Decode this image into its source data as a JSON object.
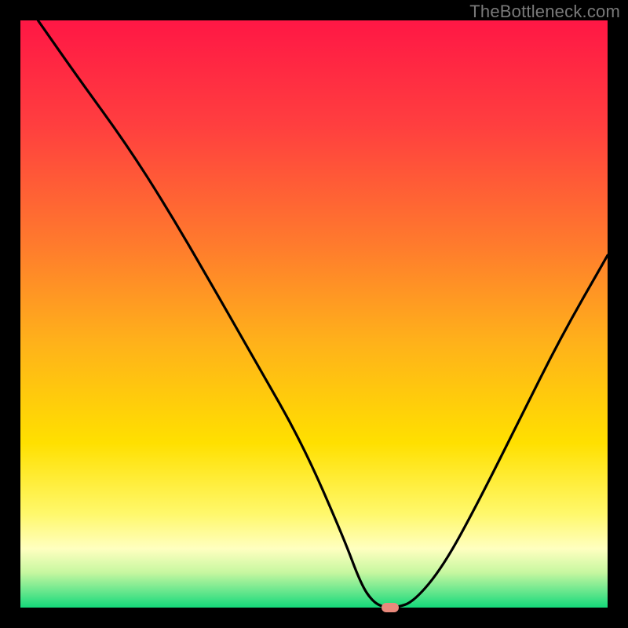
{
  "attribution": "TheBottleneck.com",
  "chart_data": {
    "type": "line",
    "title": "",
    "xlabel": "",
    "ylabel": "",
    "xlim": [
      0,
      100
    ],
    "ylim": [
      0,
      100
    ],
    "series": [
      {
        "name": "curve",
        "x": [
          3,
          10,
          18,
          25,
          32,
          40,
          48,
          55,
          58,
          60,
          62,
          64,
          67,
          72,
          78,
          85,
          92,
          100
        ],
        "y": [
          100,
          90,
          79,
          68,
          56,
          42,
          28,
          12,
          4,
          1,
          0,
          0,
          1,
          7,
          18,
          32,
          46,
          60
        ]
      }
    ],
    "marker": {
      "x": 63,
      "y": 0
    },
    "gradient_stops": [
      {
        "pos": 0.0,
        "color": "#ff1745"
      },
      {
        "pos": 0.18,
        "color": "#ff3f3f"
      },
      {
        "pos": 0.38,
        "color": "#ff7a2d"
      },
      {
        "pos": 0.55,
        "color": "#ffb21a"
      },
      {
        "pos": 0.72,
        "color": "#ffe000"
      },
      {
        "pos": 0.84,
        "color": "#fff86b"
      },
      {
        "pos": 0.9,
        "color": "#ffffc0"
      },
      {
        "pos": 0.94,
        "color": "#c7f7a0"
      },
      {
        "pos": 0.97,
        "color": "#6fe88f"
      },
      {
        "pos": 1.0,
        "color": "#14d97a"
      }
    ]
  }
}
